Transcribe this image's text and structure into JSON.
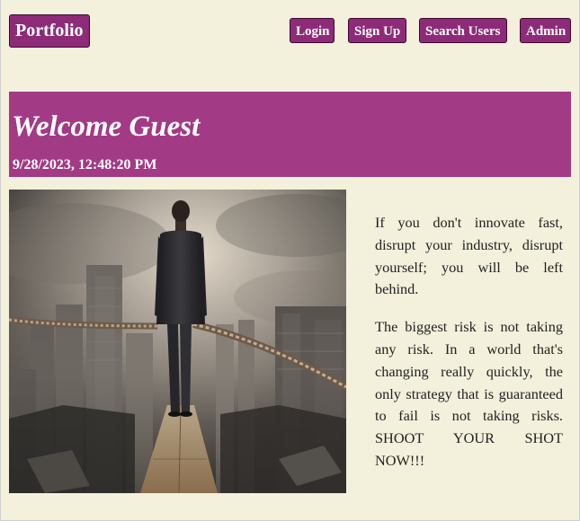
{
  "nav": {
    "brand": "Portfolio",
    "login": "Login",
    "signup": "Sign Up",
    "search_users": "Search Users",
    "admin": "Admin"
  },
  "banner": {
    "title": "Welcome Guest",
    "timestamp": "9/28/2023, 12:48:20 PM"
  },
  "quotes": [
    "If you don't innovate fast, disrupt your industry, disrupt yourself; you will be left behind.",
    "The biggest risk is not taking any risk. In a world that's changing really quickly, the only strategy that is guaranteed to fail is not taking risks. SHOOT YOUR SHOT NOW!!!"
  ],
  "colors": {
    "page_bg": "#f3f0dc",
    "nav_button": "#8e2b78",
    "banner": "#a23a86",
    "text": "#222222"
  },
  "image": {
    "semantic": "businessman-on-tightrope-over-city-photo"
  }
}
